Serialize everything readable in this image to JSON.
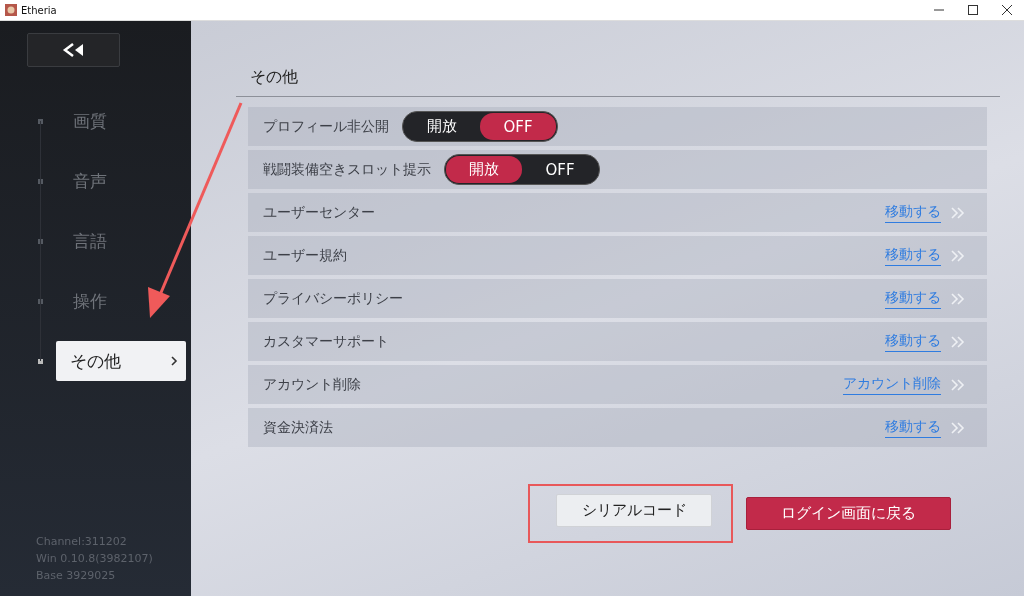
{
  "window": {
    "title": "Etheria"
  },
  "sidebar": {
    "items": [
      {
        "label": "画質",
        "selected": false
      },
      {
        "label": "音声",
        "selected": false
      },
      {
        "label": "言語",
        "selected": false
      },
      {
        "label": "操作",
        "selected": false
      },
      {
        "label": "その他",
        "selected": true
      }
    ],
    "build_info": [
      "Channel:311202",
      "Win 0.10.8(3982107)",
      "Base 3929025"
    ]
  },
  "section": {
    "title": "その他"
  },
  "settings": [
    {
      "kind": "toggle",
      "label": "プロフィール非公開",
      "options": [
        {
          "label": "開放",
          "selected": false
        },
        {
          "label": "OFF",
          "selected": true
        }
      ]
    },
    {
      "kind": "toggle",
      "label": "戦闘装備空きスロット提示",
      "options": [
        {
          "label": "開放",
          "selected": true
        },
        {
          "label": "OFF",
          "selected": false
        }
      ]
    },
    {
      "kind": "link",
      "label": "ユーザーセンター",
      "action": "移動する"
    },
    {
      "kind": "link",
      "label": "ユーザー規約",
      "action": "移動する"
    },
    {
      "kind": "link",
      "label": "プライバシーポリシー",
      "action": "移動する"
    },
    {
      "kind": "link",
      "label": "カスタマーサポート",
      "action": "移動する"
    },
    {
      "kind": "link",
      "label": "アカウント削除",
      "action": "アカウント削除"
    },
    {
      "kind": "link",
      "label": "資金決済法",
      "action": "移動する"
    }
  ],
  "buttons": [
    {
      "label": "シリアルコード",
      "kind": "secondary",
      "highlighted": true
    },
    {
      "label": "ログイン画面に戻る",
      "kind": "primary",
      "highlighted": false
    }
  ]
}
